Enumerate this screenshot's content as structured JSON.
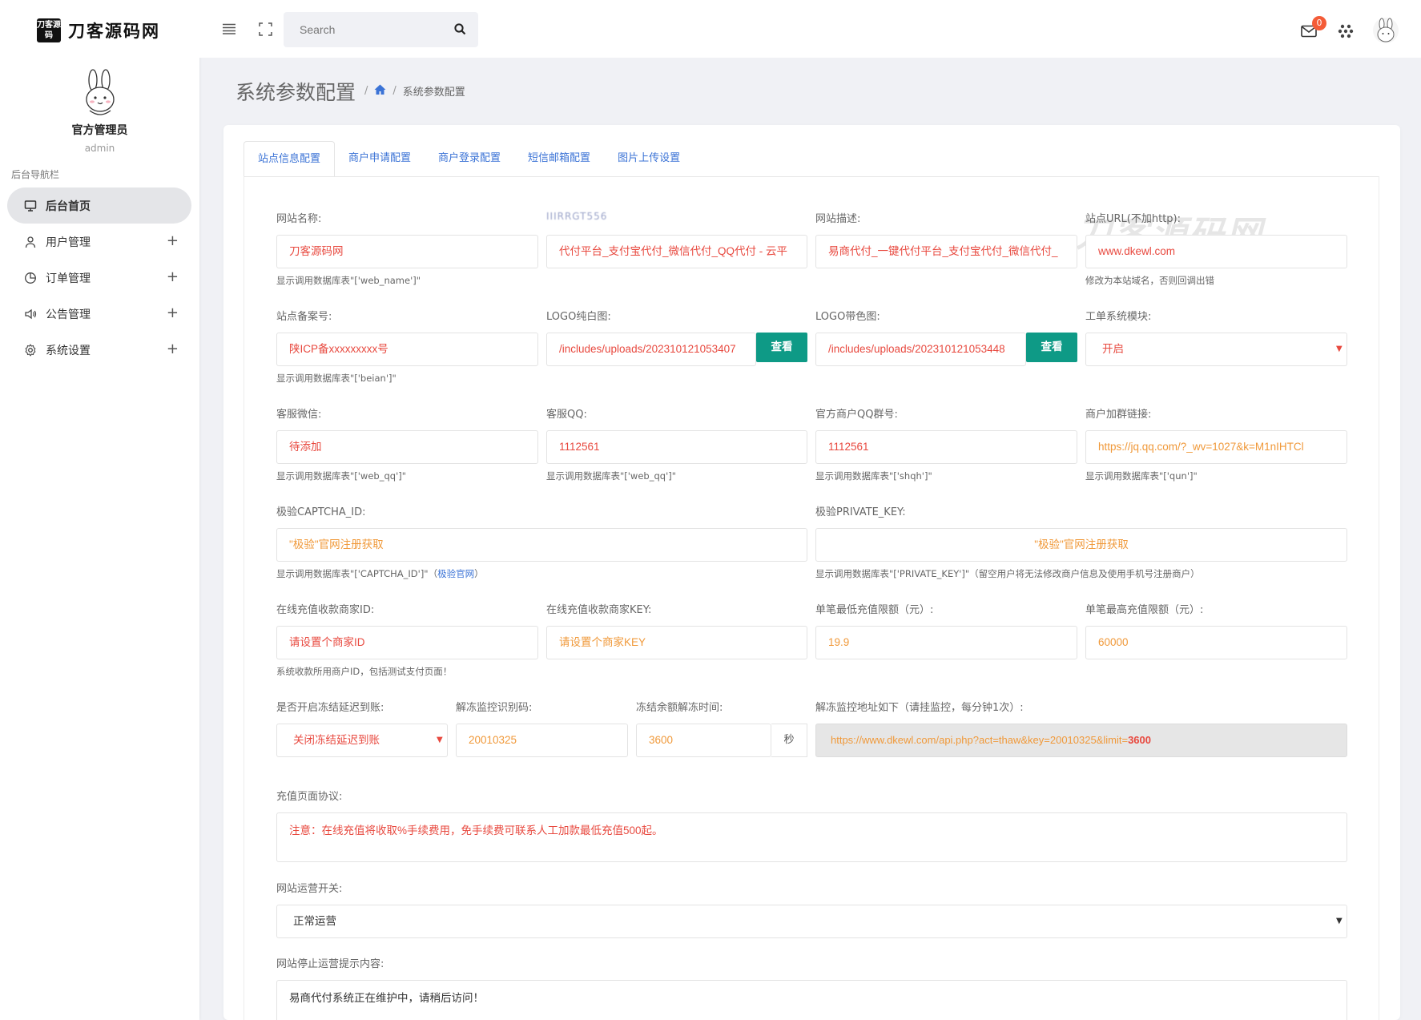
{
  "brand": {
    "mark": "刀客源码",
    "name": "刀客源码网"
  },
  "user": {
    "name": "官方管理员",
    "role": "admin"
  },
  "sidebar": {
    "title": "后台导航栏",
    "items": [
      {
        "label": "后台首页",
        "icon": "monitor-icon",
        "active": true
      },
      {
        "label": "用户管理",
        "icon": "user-icon",
        "expand": "+"
      },
      {
        "label": "订单管理",
        "icon": "pie-chart-icon",
        "expand": "+"
      },
      {
        "label": "公告管理",
        "icon": "speaker-icon",
        "expand": "+"
      },
      {
        "label": "系统设置",
        "icon": "gear-icon",
        "expand": "+"
      }
    ]
  },
  "topbar": {
    "search_placeholder": "Search",
    "mail_badge": "0"
  },
  "page": {
    "title": "系统参数配置",
    "breadcrumb_sep": "/",
    "breadcrumb_current": "系统参数配置"
  },
  "tabs": [
    {
      "label": "站点信息配置",
      "active": true
    },
    {
      "label": "商户申请配置"
    },
    {
      "label": "商户登录配置"
    },
    {
      "label": "短信邮箱配置"
    },
    {
      "label": "图片上传设置"
    }
  ],
  "watermark": "刀客源码网",
  "blurred_label": "IIIRRGT556",
  "form": {
    "site_name": {
      "label": "网站名称:",
      "value": "刀客源码网",
      "help": "显示调用数据库表\"['web_name']\""
    },
    "site_title": {
      "value": "代付平台_支付宝代付_微信代付_QQ代付 - 云平"
    },
    "site_desc": {
      "label": "网站描述:",
      "value": "易商代付_一键代付平台_支付宝代付_微信代付_"
    },
    "site_url": {
      "label": "站点URL(不加http):",
      "value": "www.dkewl.com",
      "help": "修改为本站域名，否则回调出错"
    },
    "beian": {
      "label": "站点备案号:",
      "value": "陕ICP备xxxxxxxxx号",
      "help": "显示调用数据库表\"['beian']\""
    },
    "logo_white": {
      "label": "LOGO纯白图:",
      "value": "/includes/uploads/202310121053407",
      "button": "查看"
    },
    "logo_color": {
      "label": "LOGO带色图:",
      "value": "/includes/uploads/202310121053448",
      "button": "查看"
    },
    "ticket": {
      "label": "工单系统模块:",
      "value": "开启"
    },
    "wechat": {
      "label": "客服微信:",
      "value": "待添加",
      "help": "显示调用数据库表\"['web_qq']\""
    },
    "qq": {
      "label": "客服QQ:",
      "value": "1112561",
      "help": "显示调用数据库表\"['web_qq']\""
    },
    "qq_group": {
      "label": "官方商户QQ群号:",
      "value": "1112561",
      "help": "显示调用数据库表\"['shqh']\""
    },
    "group_link": {
      "label": "商户加群链接:",
      "value": "https://jq.qq.com/?_wv=1027&k=M1nIHTCl",
      "help": "显示调用数据库表\"['qun']\""
    },
    "captcha_id": {
      "label": "极验CAPTCHA_ID:",
      "value": "\"极验\"官网注册获取",
      "help": "显示调用数据库表\"['CAPTCHA_ID']\"（",
      "help_link": "极验官网",
      "help_end": "）"
    },
    "private_key": {
      "label": "极验PRIVATE_KEY:",
      "value": "\"极验\"官网注册获取",
      "help": "显示调用数据库表\"['PRIVATE_KEY']\"（留空用户将无法修改商户信息及使用手机号注册商户）"
    },
    "merchant_id": {
      "label": "在线充值收款商家ID:",
      "value": "请设置个商家ID",
      "help": "系统收款所用商户ID，包括测试支付页面！"
    },
    "merchant_key": {
      "label": "在线充值收款商家KEY:",
      "value": "请设置个商家KEY"
    },
    "min_recharge": {
      "label": "单笔最低充值限额（元）:",
      "value": "19.9"
    },
    "max_recharge": {
      "label": "单笔最高充值限额（元）:",
      "value": "60000"
    },
    "freeze": {
      "label": "是否开启冻结延迟到账:",
      "value": "关闭冻结延迟到账"
    },
    "unfreeze_code": {
      "label": "解冻监控识别码:",
      "value": "20010325"
    },
    "unfreeze_time": {
      "label": "冻结余额解冻时间:",
      "value": "3600",
      "unit": "秒"
    },
    "unfreeze_url": {
      "label": "解冻监控地址如下（请挂监控，每分钟1次）:",
      "value": "https://www.dkewl.com/api.php?act=thaw&key=20010325&limit=",
      "value_bold": "3600"
    },
    "agreement": {
      "label": "充值页面协议:",
      "value": "注意：在线充值将收取%手续费用，免手续费可联系人工加款最低充值500起。"
    },
    "switch": {
      "label": "网站运营开关:",
      "value": "正常运营"
    },
    "stop_msg": {
      "label": "网站停止运营提示内容:",
      "value": "易商代付系统正在维护中，请稍后访问！"
    }
  }
}
